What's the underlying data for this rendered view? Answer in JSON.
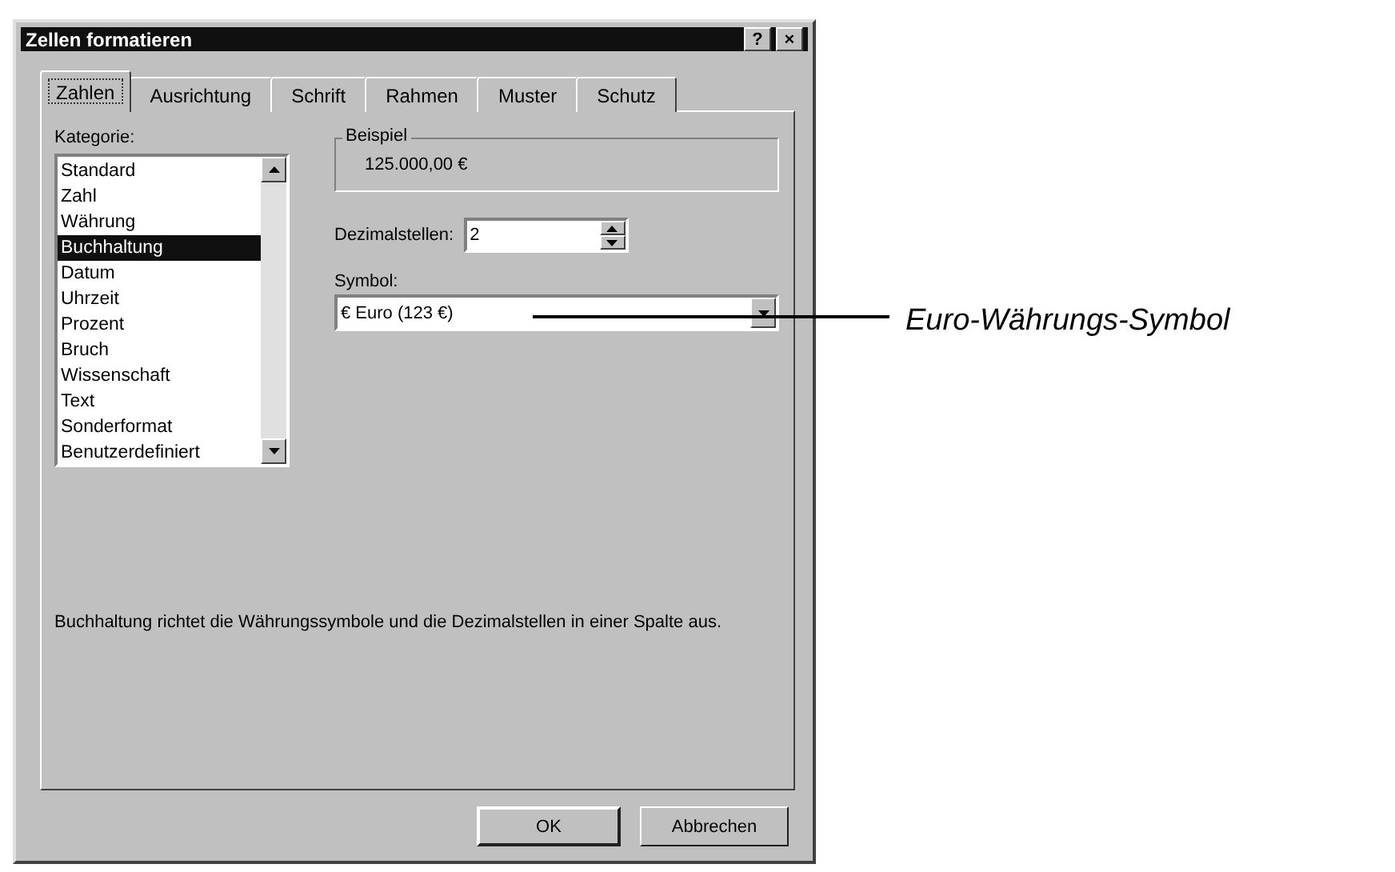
{
  "window": {
    "title": "Zellen formatieren",
    "controls": [
      "?",
      "×"
    ]
  },
  "tabs": [
    {
      "label": "Zahlen",
      "selected": true
    },
    {
      "label": "Ausrichtung",
      "selected": false
    },
    {
      "label": "Schrift",
      "selected": false
    },
    {
      "label": "Rahmen",
      "selected": false
    },
    {
      "label": "Muster",
      "selected": false
    },
    {
      "label": "Schutz",
      "selected": false
    }
  ],
  "category": {
    "label": "Kategorie:",
    "items": [
      {
        "label": "Standard",
        "selected": false
      },
      {
        "label": "Zahl",
        "selected": false
      },
      {
        "label": "Währung",
        "selected": false
      },
      {
        "label": "Buchhaltung",
        "selected": true
      },
      {
        "label": "Datum",
        "selected": false
      },
      {
        "label": "Uhrzeit",
        "selected": false
      },
      {
        "label": "Prozent",
        "selected": false
      },
      {
        "label": "Bruch",
        "selected": false
      },
      {
        "label": "Wissenschaft",
        "selected": false
      },
      {
        "label": "Text",
        "selected": false
      },
      {
        "label": "Sonderformat",
        "selected": false
      },
      {
        "label": "Benutzerdefiniert",
        "selected": false
      }
    ]
  },
  "sample": {
    "label": "Beispiel",
    "value": "125.000,00 €"
  },
  "decimals": {
    "label": "Dezimalstellen:",
    "value": "2"
  },
  "symbol": {
    "label": "Symbol:",
    "value": "€ Euro (123 €)"
  },
  "description": "Buchhaltung richtet die Währungssymbole und die Dezimalstellen in einer Spalte aus.",
  "buttons": [
    "OK",
    "Abbrechen"
  ],
  "annotation": "Euro-Währungs-Symbol"
}
